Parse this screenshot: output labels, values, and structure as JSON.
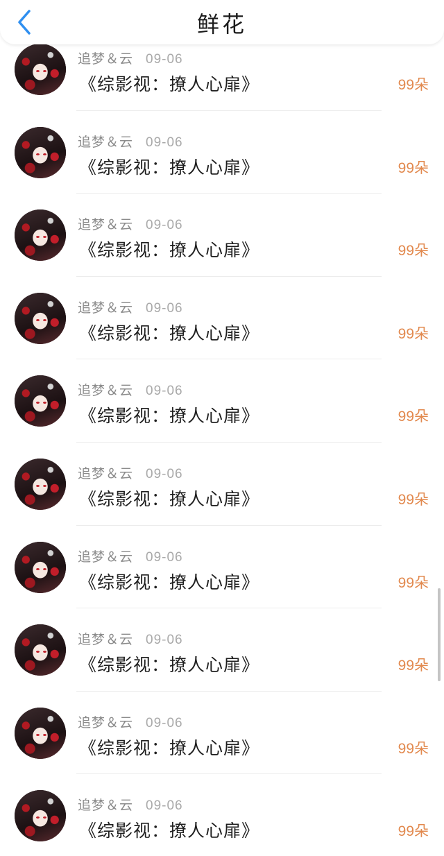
{
  "header": {
    "title": "鲜花",
    "back_icon": "chevron-left-icon",
    "accent_color": "#2f8ff0"
  },
  "colors": {
    "amount": "#e2894e",
    "meta": "#9b9b9b",
    "title": "#1f1f1f"
  },
  "rows": [
    {
      "name": "追梦＆云",
      "date": "09-06",
      "title": "《综影视：撩人心扉》",
      "amount": "99朵"
    },
    {
      "name": "追梦＆云",
      "date": "09-06",
      "title": "《综影视：撩人心扉》",
      "amount": "99朵"
    },
    {
      "name": "追梦＆云",
      "date": "09-06",
      "title": "《综影视：撩人心扉》",
      "amount": "99朵"
    },
    {
      "name": "追梦＆云",
      "date": "09-06",
      "title": "《综影视：撩人心扉》",
      "amount": "99朵"
    },
    {
      "name": "追梦＆云",
      "date": "09-06",
      "title": "《综影视：撩人心扉》",
      "amount": "99朵"
    },
    {
      "name": "追梦＆云",
      "date": "09-06",
      "title": "《综影视：撩人心扉》",
      "amount": "99朵"
    },
    {
      "name": "追梦＆云",
      "date": "09-06",
      "title": "《综影视：撩人心扉》",
      "amount": "99朵"
    },
    {
      "name": "追梦＆云",
      "date": "09-06",
      "title": "《综影视：撩人心扉》",
      "amount": "99朵"
    },
    {
      "name": "追梦＆云",
      "date": "09-06",
      "title": "《综影视：撩人心扉》",
      "amount": "99朵"
    },
    {
      "name": "追梦＆云",
      "date": "09-06",
      "title": "《综影视：撩人心扉》",
      "amount": "99朵"
    }
  ]
}
